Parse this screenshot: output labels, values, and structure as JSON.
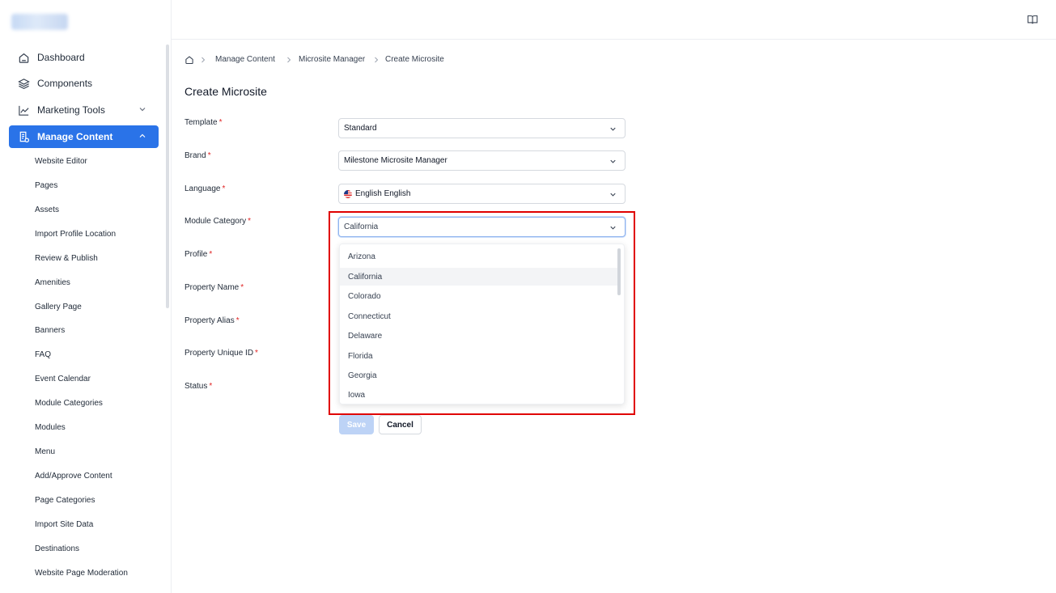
{
  "sidebar": {
    "top_items": [
      {
        "label": "Dashboard",
        "icon": "home-icon"
      },
      {
        "label": "Components",
        "icon": "layers-icon"
      },
      {
        "label": "Marketing Tools",
        "icon": "chart-line-icon"
      },
      {
        "label": "Manage Content",
        "icon": "document-icon"
      }
    ],
    "sub_items": [
      "Website Editor",
      "Pages",
      "Assets",
      "Import Profile Location",
      "Review & Publish",
      "Amenities",
      "Gallery Page",
      "Banners",
      "FAQ",
      "Event Calendar",
      "Module Categories",
      "Modules",
      "Menu",
      "Add/Approve Content",
      "Page Categories",
      "Import Site Data",
      "Destinations",
      "Website Page Moderation"
    ]
  },
  "breadcrumb": {
    "items": [
      "Manage Content",
      "Microsite Manager",
      "Create Microsite"
    ]
  },
  "page": {
    "title": "Create Microsite"
  },
  "form": {
    "required_mark": "*",
    "labels": [
      "Template",
      "Brand",
      "Language",
      "Module Category",
      "Profile",
      "Property Name",
      "Property Alias",
      "Property Unique ID",
      "Status"
    ],
    "template_value": "Standard",
    "brand_value": "Milestone Microsite Manager",
    "language_value": "English English",
    "module_category_value": "California"
  },
  "dropdown": {
    "options": [
      "Arizona",
      "California",
      "Colorado",
      "Connecticut",
      "Delaware",
      "Florida",
      "Georgia",
      "Iowa"
    ],
    "selected": "California"
  },
  "buttons": {
    "save": "Save",
    "cancel": "Cancel"
  },
  "colors": {
    "accent": "#2a73e8",
    "required": "#e02424",
    "highlight": "#e00000"
  }
}
